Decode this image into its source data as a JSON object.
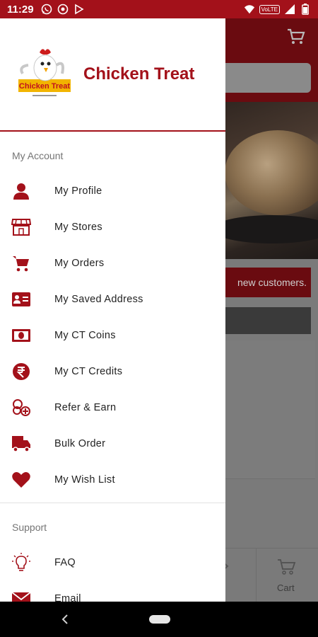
{
  "status_bar": {
    "time": "11:29",
    "icons": [
      "whatsapp-icon",
      "notification-icon",
      "play-icon",
      "wifi-icon",
      "volte-icon",
      "signal-icon",
      "battery-icon"
    ],
    "volte_label": "VoLTE"
  },
  "background": {
    "promo_text": "new customers.",
    "nav_labels": [
      "rs",
      "Cart"
    ]
  },
  "drawer": {
    "brand": "Chicken Treat",
    "logo_text": "Chicken Treat",
    "account_title": "My Account",
    "account_items": [
      {
        "label": "My Profile",
        "icon": "profile-icon"
      },
      {
        "label": "My Stores",
        "icon": "store-icon"
      },
      {
        "label": "My Orders",
        "icon": "cart-icon"
      },
      {
        "label": "My Saved Address",
        "icon": "address-card-icon"
      },
      {
        "label": "My CT Coins",
        "icon": "cash-icon"
      },
      {
        "label": "My CT Credits",
        "icon": "rupee-icon"
      },
      {
        "label": "Refer & Earn",
        "icon": "refer-coins-icon"
      },
      {
        "label": "Bulk Order",
        "icon": "truck-icon"
      },
      {
        "label": "My Wish List",
        "icon": "heart-icon"
      }
    ],
    "support_title": "Support",
    "support_items": [
      {
        "label": "FAQ",
        "icon": "lightbulb-icon"
      },
      {
        "label": "Email",
        "icon": "email-icon"
      }
    ]
  },
  "colors": {
    "brand_red": "#a3111a",
    "status_bar": "#a3111a",
    "scrim_gray": "#7a7a7a"
  }
}
